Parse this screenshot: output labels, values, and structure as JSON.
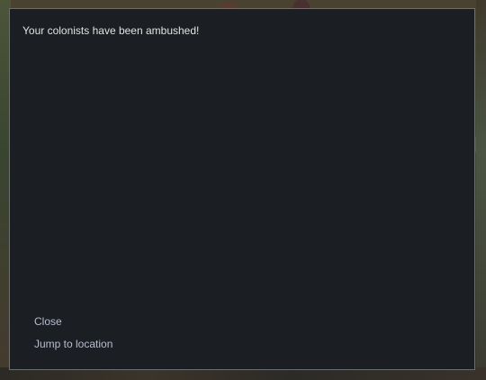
{
  "letter": {
    "text": "Your colonists have been ambushed!",
    "options": [
      {
        "label": "Close"
      },
      {
        "label": "Jump to location"
      }
    ]
  },
  "colors": {
    "dialog_background": "#1b1e22",
    "dialog_border": "#6b6f74",
    "body_text": "#e2e2e2",
    "option_text": "#b8bdd0"
  }
}
